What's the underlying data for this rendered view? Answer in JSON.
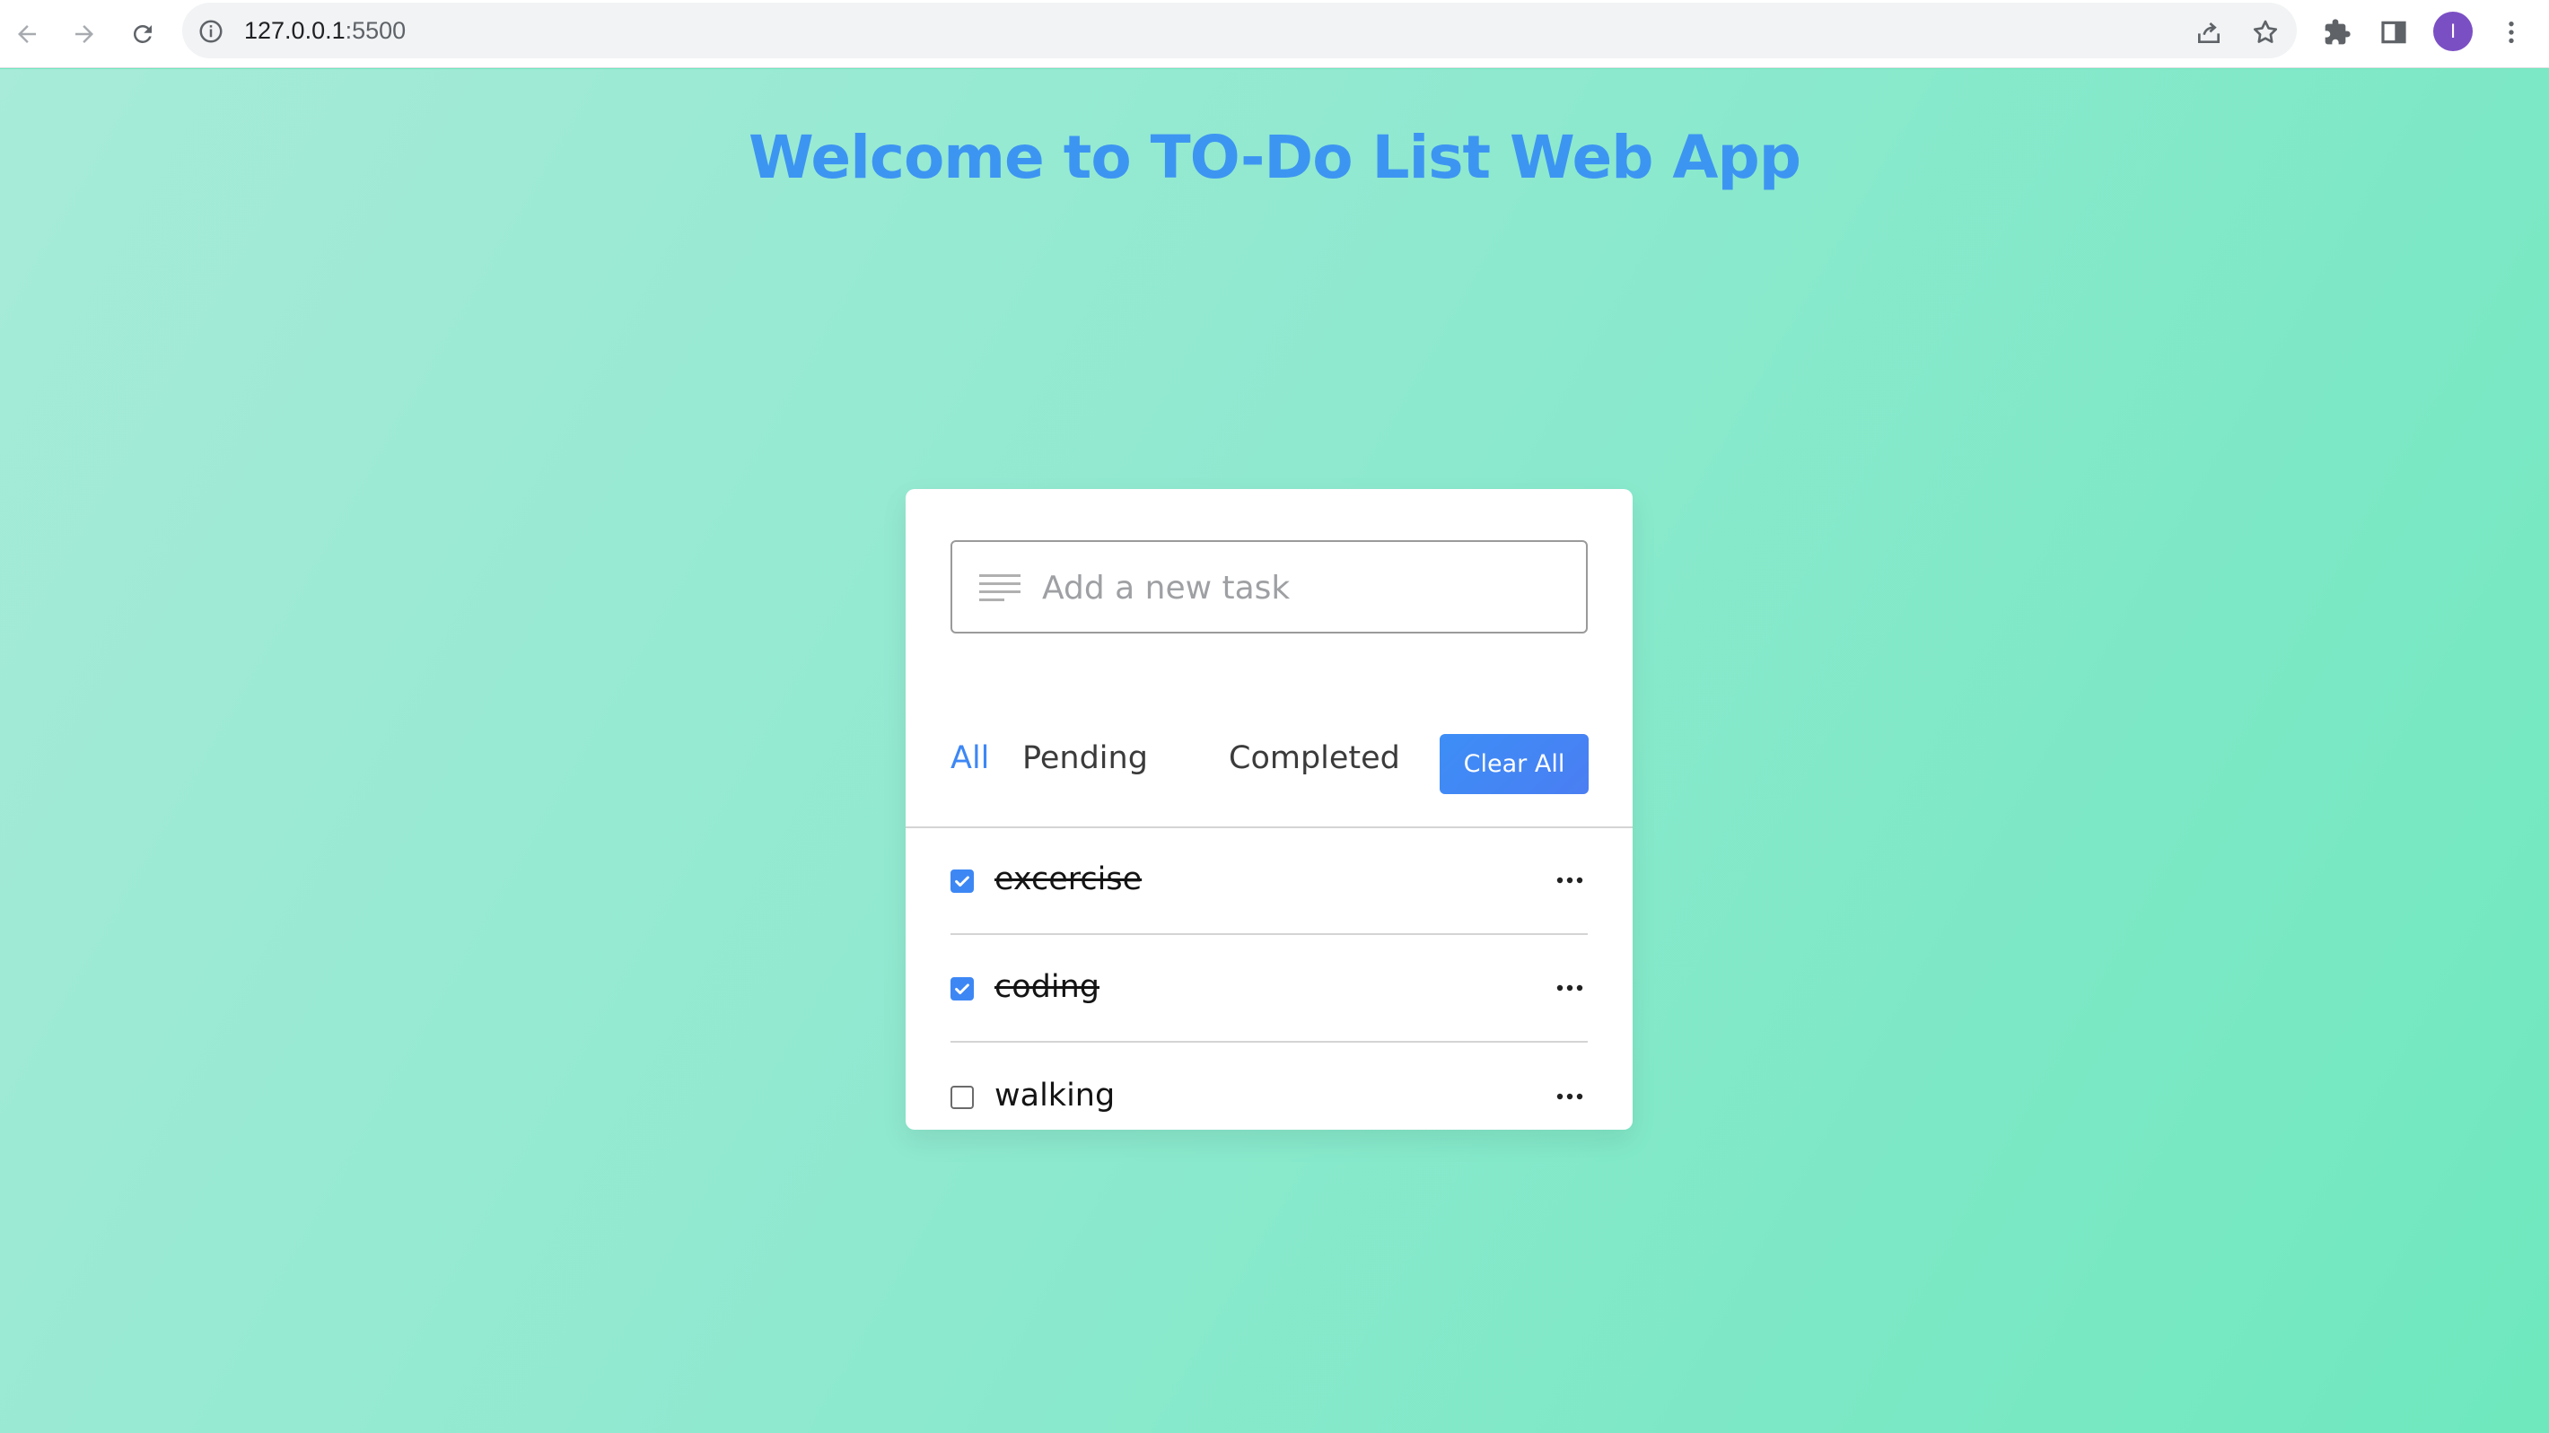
{
  "browser": {
    "url_host": "127.0.0.1",
    "url_port": ":5500",
    "avatar_letter": "I",
    "icons": [
      "back-arrow-icon",
      "forward-arrow-icon",
      "reload-icon",
      "info-icon",
      "share-icon",
      "star-icon",
      "extensions-icon",
      "side-panel-icon",
      "kebab-menu-icon"
    ]
  },
  "page": {
    "title": "Welcome to TO-Do List Web App"
  },
  "todo": {
    "input_placeholder": "Add a new task",
    "input_value": "",
    "filters": [
      {
        "label": "All",
        "active": true
      },
      {
        "label": "Pending",
        "active": false
      },
      {
        "label": "Completed",
        "active": false
      }
    ],
    "clear_label": "Clear All",
    "tasks": [
      {
        "label": "excercise",
        "completed": true
      },
      {
        "label": "coding",
        "completed": true
      },
      {
        "label": "walking",
        "completed": false
      }
    ]
  },
  "colors": {
    "accent": "#3d87f5",
    "title": "#3d95f2",
    "background": "#8fe9cf"
  }
}
